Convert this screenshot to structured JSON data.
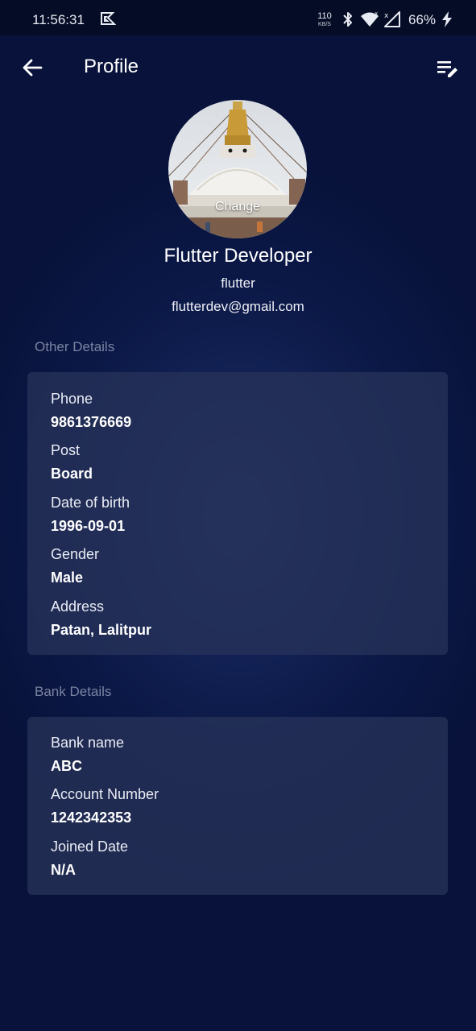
{
  "status_bar": {
    "time": "11:56:31",
    "net_speed": "110",
    "net_speed_unit": "KB/S",
    "battery": "66%"
  },
  "app_bar": {
    "title": "Profile"
  },
  "profile": {
    "change_label": "Change",
    "name": "Flutter Developer",
    "username": "flutter",
    "email": "flutterdev@gmail.com"
  },
  "other_details": {
    "heading": "Other Details",
    "fields": [
      {
        "label": "Phone",
        "value": "9861376669"
      },
      {
        "label": "Post",
        "value": "Board"
      },
      {
        "label": "Date of birth",
        "value": "1996-09-01"
      },
      {
        "label": "Gender",
        "value": "Male"
      },
      {
        "label": "Address",
        "value": "Patan, Lalitpur"
      }
    ]
  },
  "bank_details": {
    "heading": "Bank Details",
    "fields": [
      {
        "label": "Bank name",
        "value": "ABC"
      },
      {
        "label": "Account Number",
        "value": "1242342353"
      },
      {
        "label": "Joined Date",
        "value": "N/A"
      }
    ]
  },
  "colors": {
    "background": "#0b1846",
    "status_bar": "#050c25",
    "card": "#263258",
    "section_heading": "#7a83a1"
  },
  "icons": {
    "back": "arrow-left-icon",
    "edit": "list-edit-icon",
    "bluetooth": "bluetooth-icon",
    "wifi": "wifi-icon",
    "signal": "signal-icon",
    "charging": "charging-bolt-icon",
    "notification": "app-notification-icon"
  }
}
